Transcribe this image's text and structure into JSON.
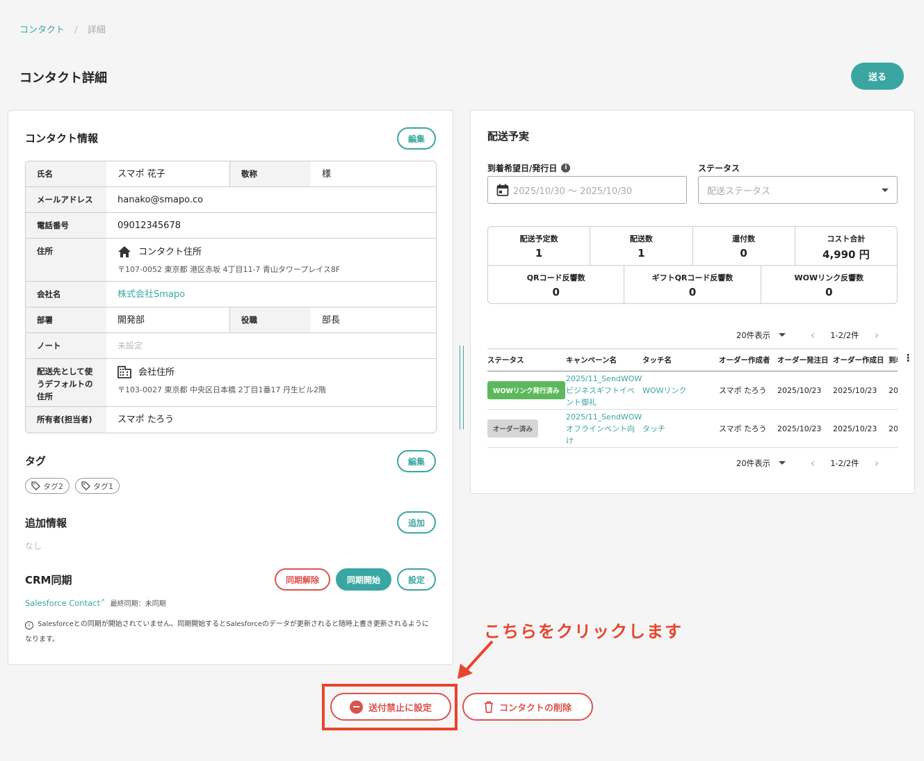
{
  "breadcrumb": {
    "parent": "コンタクト",
    "sep": "/",
    "current": "詳細"
  },
  "page_title": "コンタクト詳細",
  "send_label": "送る",
  "contact": {
    "title": "コンタクト情報",
    "edit_label": "編集",
    "name_label": "氏名",
    "name": "スマポ 花子",
    "honorific_label": "敬称",
    "honorific": "様",
    "email_label": "メールアドレス",
    "email": "hanako@smapo.co",
    "phone_label": "電話番号",
    "phone": "09012345678",
    "address_label": "住所",
    "address_type": "コンタクト住所",
    "address": "〒107-0052 東京都 港区赤坂 4丁目11-7 青山タワープレイス8F",
    "company_label": "会社名",
    "company": "株式会社Smapo",
    "dept_label": "部署",
    "dept": "開発部",
    "position_label": "役職",
    "position": "部長",
    "note_label": "ノート",
    "note": "未設定",
    "default_addr_label": "配送先として使うデフォルトの住所",
    "default_addr_type": "会社住所",
    "default_addr": "〒103-0027 東京都 中央区日本橋 2丁目1番17 丹生ビル2階",
    "owner_label": "所有者(担当者)",
    "owner": "スマポ たろう"
  },
  "tags": {
    "title": "タグ",
    "edit_label": "編集",
    "items": [
      "タグ2",
      "タグ1"
    ]
  },
  "extra": {
    "title": "追加情報",
    "add_label": "追加",
    "empty": "なし"
  },
  "crm": {
    "title": "CRM同期",
    "unsync_label": "同期解除",
    "start_label": "同期開始",
    "settings_label": "設定",
    "link": "Salesforce Contact",
    "last_sync": "最終同期：未同期",
    "notice": "Salesforceとの同期が開始されていません。同期開始するとSalesforceのデータが更新されると随時上書き更新されるようになります。"
  },
  "shipping": {
    "title": "配送予実",
    "date_label": "到着希望日/発行日",
    "date_value": "2025/10/30 〜 2025/10/30",
    "status_label": "ステータス",
    "status_placeholder": "配送ステータス",
    "stats_row1": [
      {
        "k": "配送予定数",
        "v": "1"
      },
      {
        "k": "配送数",
        "v": "1"
      },
      {
        "k": "還付数",
        "v": "0"
      },
      {
        "k": "コスト合計",
        "v": "4,990 円"
      }
    ],
    "stats_row2": [
      {
        "k": "QRコード反響数",
        "v": "0"
      },
      {
        "k": "ギフトQRコード反響数",
        "v": "0"
      },
      {
        "k": "WOWリンク反響数",
        "v": "0"
      }
    ],
    "per_page": "20件表示",
    "range": "1-2/2件",
    "columns": [
      "ステータス",
      "キャンペーン名",
      "タッチ名",
      "オーダー作成者",
      "オーダー発注日",
      "オーダー作成日",
      "到着"
    ],
    "rows": [
      {
        "status": "WOWリンク発行済み",
        "campaign": "2025/11_SendWOWビジネスギフトイベント御礼",
        "touch": "WOWリンク",
        "creator": "スマポ たろう",
        "order_date": "2025/10/23",
        "created": "2025/10/23",
        "arrive": "20"
      },
      {
        "status": "オーダー済み",
        "campaign": "2025/11_SendWOWオフラインベント向け",
        "touch": "タッチ",
        "creator": "スマポ たろう",
        "order_date": "2025/10/23",
        "created": "2025/10/23",
        "arrive": "20"
      }
    ],
    "colors": {
      "badge_green": "#5cb85c",
      "badge_gray": "#d6d6d6"
    }
  },
  "annotation": "こちらをクリックします",
  "actions": {
    "block_label": "送付禁止に設定",
    "delete_label": "コンタクトの削除"
  },
  "colors": {
    "accent": "#3aa6a2",
    "danger": "#d9534f",
    "annotation": "#e8452c"
  }
}
